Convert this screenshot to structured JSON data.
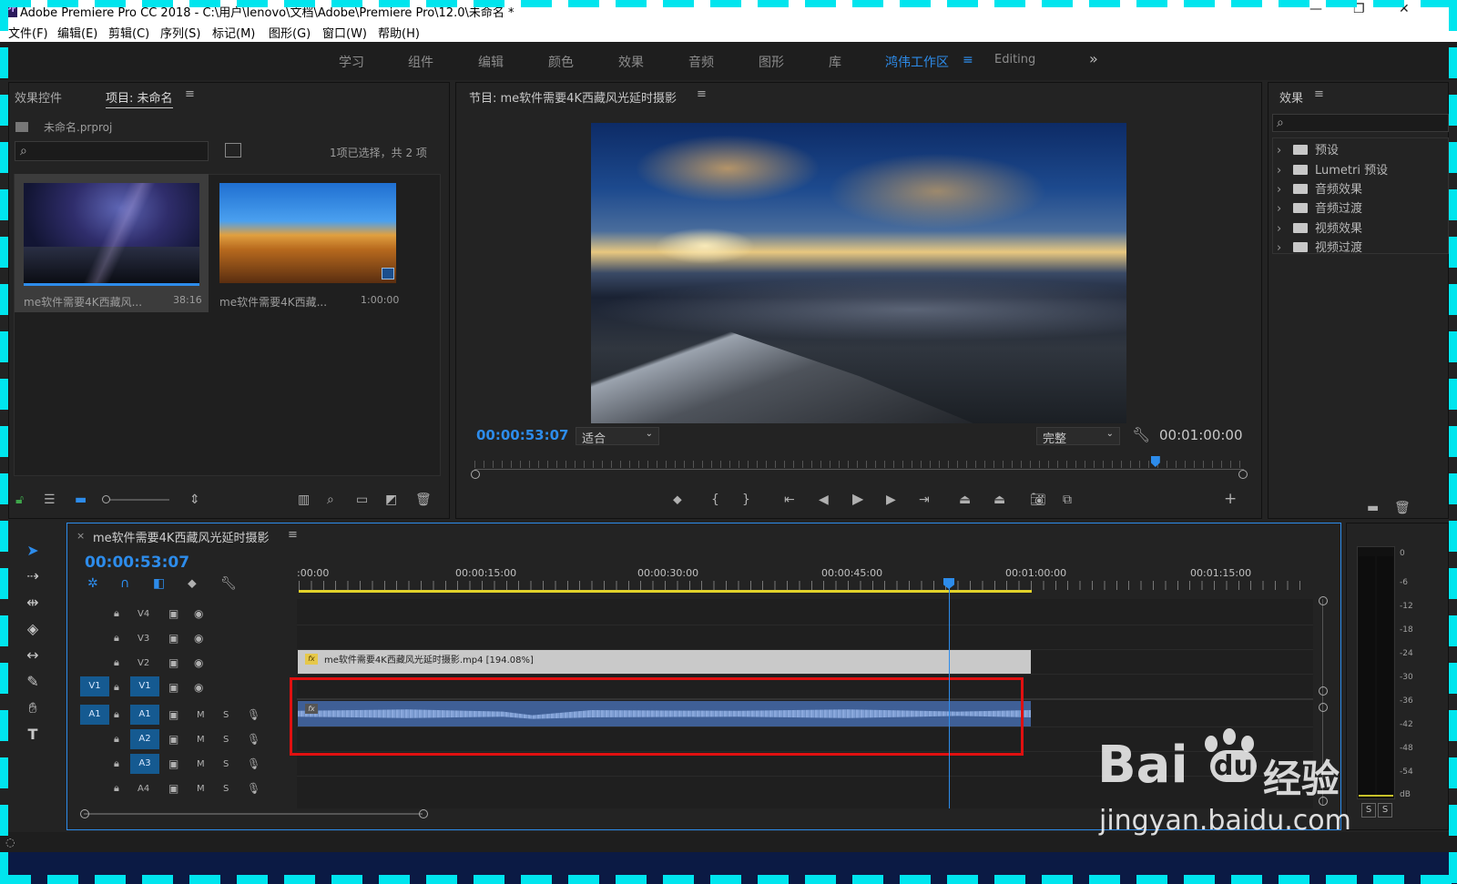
{
  "window": {
    "title": "Adobe Premiere Pro CC 2018 - C:\\用户\\lenovo\\文档\\Adobe\\Premiere Pro\\12.0\\未命名 *",
    "logo_text": "Pr"
  },
  "menu": [
    "文件(F)",
    "编辑(E)",
    "剪辑(C)",
    "序列(S)",
    "标记(M)",
    "图形(G)",
    "窗口(W)",
    "帮助(H)"
  ],
  "workspaces": [
    "学习",
    "组件",
    "编辑",
    "颜色",
    "效果",
    "音频",
    "图形",
    "库",
    "鸿伟工作区",
    "Editing"
  ],
  "workspace_active": "鸿伟工作区",
  "project_panel": {
    "tab_effect_controls": "效果控件",
    "tab_project": "项目: 未命名",
    "project_file": "未命名.prproj",
    "selection_info": "1项已选择，共 2 项",
    "items": [
      {
        "name": "me软件需要4K西藏风...",
        "duration": "38:16"
      },
      {
        "name": "me软件需要4K西藏...",
        "duration": "1:00:00"
      }
    ]
  },
  "program_monitor": {
    "title": "节目: me软件需要4K西藏风光延时摄影",
    "current_tc": "00:00:53:07",
    "fit": "适合",
    "quality": "完整",
    "duration_tc": "00:01:00:00",
    "playhead_fraction": 0.885
  },
  "effects_panel": {
    "title": "效果",
    "items": [
      "预设",
      "Lumetri 预设",
      "音频效果",
      "音频过渡",
      "视频效果",
      "视频过渡"
    ]
  },
  "timeline": {
    "title": "me软件需要4K西藏风光延时摄影",
    "current_tc": "00:00:53:07",
    "ruler": [
      ":00:00",
      "00:00:15:00",
      "00:00:30:00",
      "00:00:45:00",
      "00:01:00:00",
      "00:01:15:00"
    ],
    "video_tracks": [
      "V4",
      "V3",
      "V2",
      "V1"
    ],
    "audio_tracks": [
      "A1",
      "A2",
      "A3",
      "A4"
    ],
    "source_v": "V1",
    "source_a": "A1",
    "clip_label": "me软件需要4K西藏风光延时摄影.mp4 [194.08%]",
    "mute": "M",
    "solo": "S"
  },
  "audio_meter": {
    "scale": [
      "0",
      "-6",
      "-12",
      "-18",
      "-24",
      "-30",
      "-36",
      "-42",
      "-48",
      "-54",
      "dB"
    ],
    "solo_labels": [
      "S",
      "S"
    ]
  },
  "watermark": {
    "brand": "Bai",
    "brand2": "du",
    "cn": "经验",
    "url": "jingyan.baidu.com"
  },
  "colors": {
    "accent": "#2d8ceb",
    "clip_video": "#c9c9c9",
    "clip_audio": "#6e8fc4",
    "highlight_box": "#e01010",
    "track_target": "#155a91"
  }
}
